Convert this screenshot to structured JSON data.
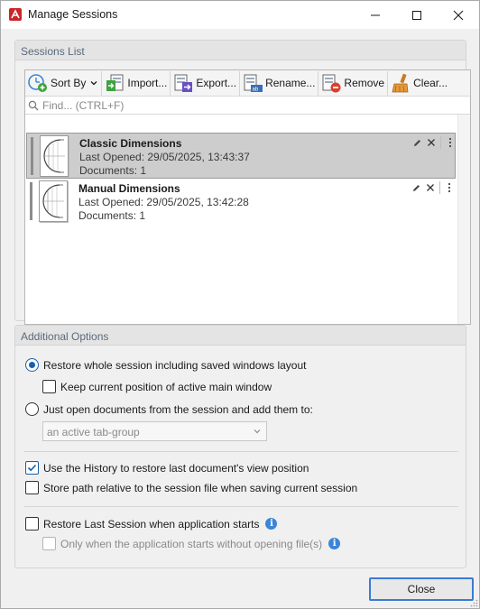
{
  "window": {
    "title": "Manage Sessions",
    "icon": "pdf-app-icon"
  },
  "sessions_group": {
    "title": "Sessions List",
    "toolbar": {
      "sort_by": "Sort By",
      "import": "Import...",
      "export": "Export...",
      "rename": "Rename...",
      "remove": "Remove",
      "clear": "Clear..."
    },
    "find_placeholder": "Find... (CTRL+F)",
    "sessions": [
      {
        "name": "Classic Dimensions",
        "last_opened": "Last Opened: 29/05/2025, 13:43:37",
        "documents": "Documents: 1",
        "selected": true
      },
      {
        "name": "Manual Dimensions",
        "last_opened": "Last Opened: 29/05/2025, 13:42:28",
        "documents": "Documents: 1",
        "selected": false
      }
    ]
  },
  "options_group": {
    "title": "Additional Options",
    "restore_whole": "Restore whole session including saved windows layout",
    "keep_position": "Keep current position of active main window",
    "just_open": "Just open documents from the session and add them to:",
    "target_select": "an active tab-group",
    "use_history": "Use the History to restore last document's view position",
    "store_relative": "Store path relative to the session file when saving current session",
    "restore_last": "Restore Last Session when application starts",
    "only_when": "Only when the application starts without opening file(s)"
  },
  "footer": {
    "close": "Close"
  },
  "colors": {
    "accent": "#1b5fa8",
    "selection": "#cdcdcd",
    "info": "#3a85d6",
    "app_icon": "#c9252b"
  }
}
